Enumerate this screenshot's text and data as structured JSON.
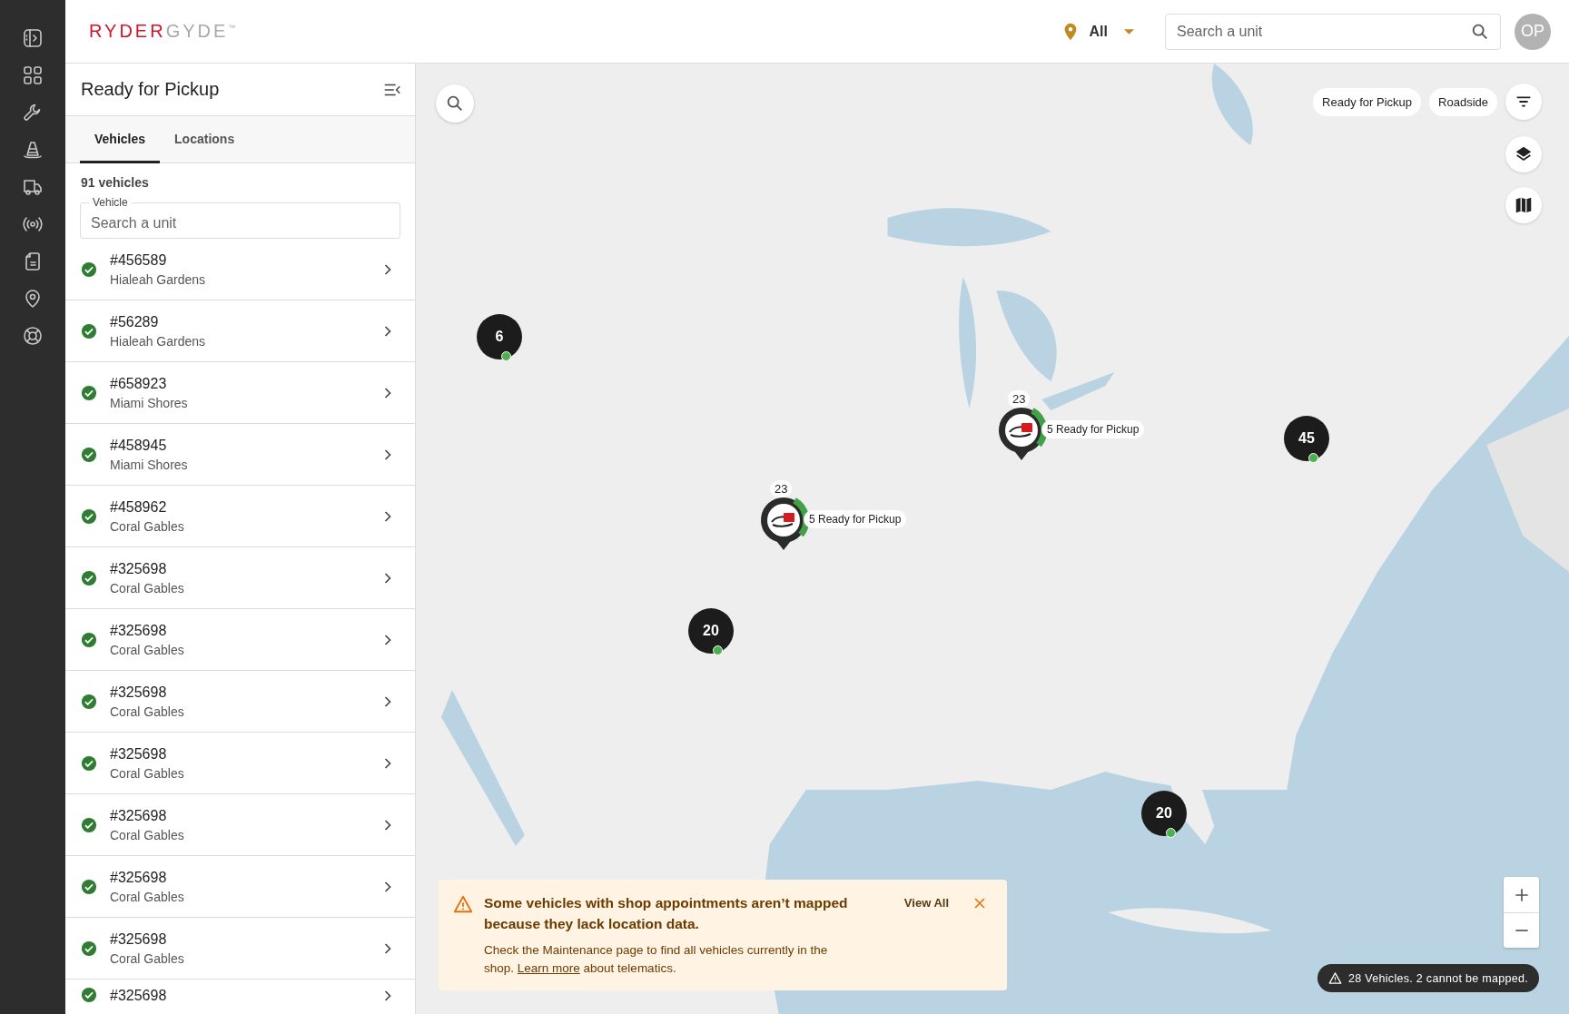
{
  "header": {
    "brand": {
      "primary": "RYDER",
      "secondary": "GYDE",
      "mark": "™"
    },
    "location_filter": {
      "value": "All"
    },
    "search": {
      "placeholder": "Search a unit"
    },
    "avatar": {
      "initials": "OP"
    }
  },
  "sidebar": {
    "title": "Ready for Pickup",
    "tabs": [
      {
        "label": "Vehicles",
        "selected": true
      },
      {
        "label": "Locations",
        "selected": false
      }
    ],
    "count": "91 vehicles",
    "search": {
      "label": "Vehicle",
      "placeholder": "Search a unit"
    },
    "vehicles": [
      {
        "unit": "#456589",
        "location": "Hialeah Gardens"
      },
      {
        "unit": "#56289",
        "location": "Hialeah Gardens"
      },
      {
        "unit": "#658923",
        "location": "Miami Shores"
      },
      {
        "unit": "#458945",
        "location": "Miami Shores"
      },
      {
        "unit": "#458962",
        "location": "Coral Gables"
      },
      {
        "unit": "#325698",
        "location": "Coral Gables"
      },
      {
        "unit": "#325698",
        "location": "Coral Gables"
      },
      {
        "unit": "#325698",
        "location": "Coral Gables"
      },
      {
        "unit": "#325698",
        "location": "Coral Gables"
      },
      {
        "unit": "#325698",
        "location": "Coral Gables"
      },
      {
        "unit": "#325698",
        "location": "Coral Gables"
      },
      {
        "unit": "#325698",
        "location": "Coral Gables"
      },
      {
        "unit": "#325698"
      }
    ]
  },
  "map": {
    "chips": [
      {
        "label": "Ready for Pickup"
      },
      {
        "label": "Roadside"
      }
    ],
    "clusters": [
      {
        "count": "6"
      },
      {
        "count": "20"
      },
      {
        "count": "45"
      },
      {
        "count": "20"
      }
    ],
    "pins": [
      {
        "count": "23",
        "label": "5 Ready for Pickup"
      },
      {
        "count": "23",
        "label": "5 Ready for Pickup"
      }
    ],
    "alert": {
      "title": "Some vehicles with shop appointments aren’t mapped because they lack location data.",
      "body_before": "Check the Maintenance page to find all vehicles currently in the shop. ",
      "link": "Learn more",
      "body_after": " about telematics.",
      "action": "View All"
    },
    "notice": "28 Vehicles. 2 cannot be mapped."
  }
}
